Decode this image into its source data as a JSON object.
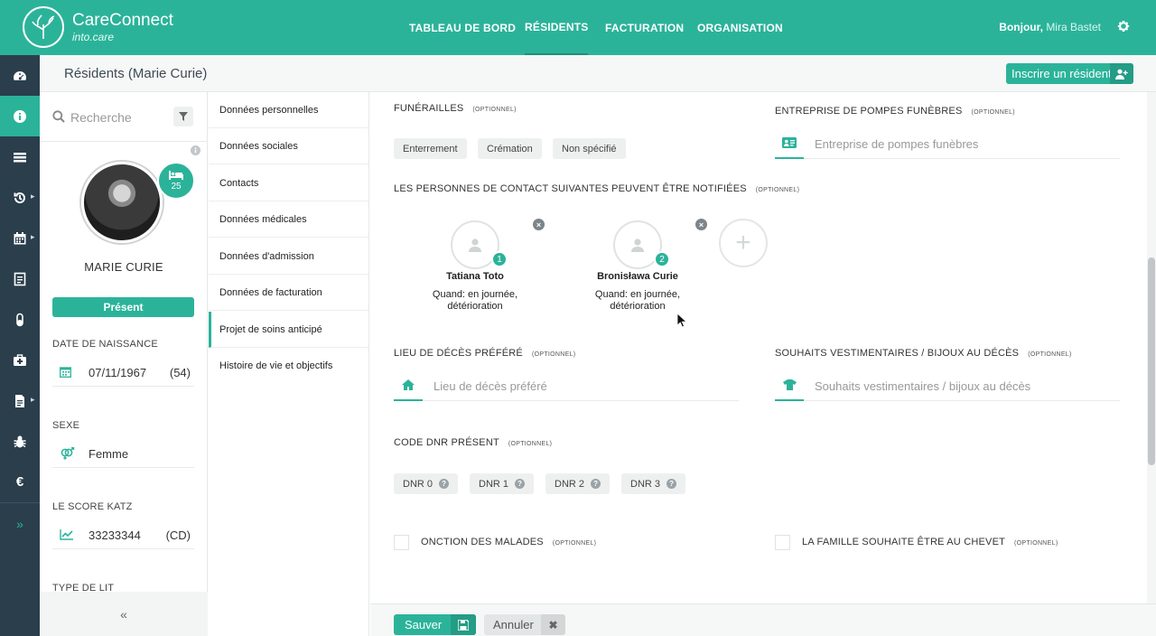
{
  "app": {
    "name": "CareConnect",
    "sub": "into.care"
  },
  "nav": [
    "TABLEAU DE BORD",
    "RÉSIDENTS",
    "FACTURATION",
    "ORGANISATION"
  ],
  "greeting": {
    "hello": "Bonjour,",
    "user": "Mira Bastet"
  },
  "page": {
    "title": "Résidents (Marie Curie)",
    "enroll_label": "Inscrire un résident"
  },
  "profile": {
    "search_placeholder": "Recherche",
    "bed_number": "25",
    "name": "MARIE CURIE",
    "status": "Présent",
    "dob_label": "DATE DE NAISSANCE",
    "dob": "07/11/1967",
    "age": "(54)",
    "sex_label": "SEXE",
    "sex": "Femme",
    "katz_label": "LE SCORE KATZ",
    "katz": "33233344",
    "katz_extra": "(CD)",
    "bed_type_label": "TYPE DE LIT",
    "collapse": "«"
  },
  "sections": [
    "Données personnelles",
    "Données sociales",
    "Contacts",
    "Données médicales",
    "Données d'admission",
    "Données de facturation",
    "Projet de soins anticipé",
    "Histoire de vie et objectifs"
  ],
  "form": {
    "optional": "(OPTIONNEL)",
    "funeral_label": "FUNÉRAILLES",
    "funeral_options": [
      "Enterrement",
      "Crémation",
      "Non spécifié"
    ],
    "undertaker_label": "ENTREPRISE DE POMPES FUNÈBRES",
    "undertaker_placeholder": "Entreprise de pompes funèbres",
    "contacts_label": "LES PERSONNES DE CONTACT SUIVANTES PEUVENT ÊTRE NOTIFIÉES",
    "contacts": [
      {
        "num": "1",
        "name": "Tatiana Toto",
        "when": "Quand: en journée, détérioration"
      },
      {
        "num": "2",
        "name": "Bronisława Curie",
        "when": "Quand: en journée, détérioration"
      }
    ],
    "death_place_label": "LIEU DE DÉCÈS PRÉFÉRÉ",
    "death_place_placeholder": "Lieu de décès préféré",
    "clothing_label": "SOUHAITS VESTIMENTAIRES / BIJOUX AU DÉCÈS",
    "clothing_placeholder": "Souhaits vestimentaires / bijoux au décès",
    "dnr_label": "CODE DNR PRÉSENT",
    "dnr_options": [
      "DNR 0",
      "DNR 1",
      "DNR 2",
      "DNR 3"
    ],
    "anointing_label": "ONCTION DES MALADES",
    "family_label": "LA FAMILLE SOUHAITE ÊTRE AU CHEVET"
  },
  "footer": {
    "save": "Sauver",
    "cancel": "Annuler"
  },
  "colors": {
    "accent": "#2bb39a",
    "accent_dark": "#249c86",
    "rail": "#2a3e4c"
  }
}
